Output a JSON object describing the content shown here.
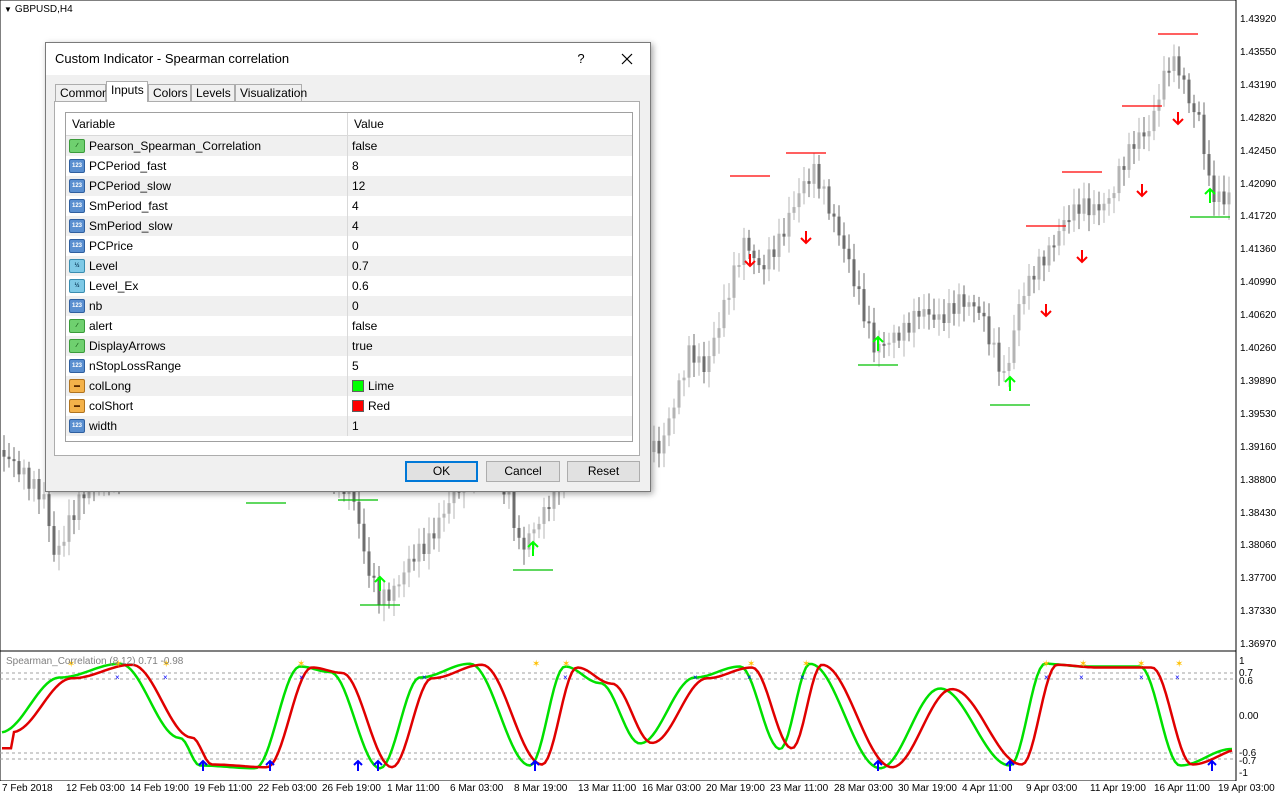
{
  "chart": {
    "title": "GBPUSD,H4",
    "price_labels": [
      "1.43920",
      "1.43550",
      "1.43190",
      "1.42820",
      "1.42450",
      "1.42090",
      "1.41720",
      "1.41360",
      "1.40990",
      "1.40620",
      "1.40260",
      "1.39890",
      "1.39530",
      "1.39160",
      "1.38800",
      "1.38430",
      "1.38060",
      "1.37700",
      "1.37330",
      "1.36970"
    ],
    "time_labels": [
      "7 Feb 2018",
      "12 Feb 03:00",
      "14 Feb 19:00",
      "19 Feb 11:00",
      "22 Feb 03:00",
      "26 Feb 19:00",
      "1 Mar 11:00",
      "6 Mar 03:00",
      "8 Mar 19:00",
      "13 Mar 11:00",
      "16 Mar 03:00",
      "20 Mar 19:00",
      "23 Mar 11:00",
      "28 Mar 03:00",
      "30 Mar 19:00",
      "4 Apr 11:00",
      "9 Apr 03:00",
      "11 Apr 19:00",
      "16 Apr 11:00",
      "19 Apr 03:00"
    ],
    "colors": {
      "bull": "#b4b4b4",
      "bear": "#6e6e6e",
      "arrow_up": "#00ff00",
      "arrow_down": "#ff0000",
      "stop_long": "#00c000",
      "stop_short": "#ff0000"
    }
  },
  "indicator": {
    "label": "Spearman_Correlation (8,12) 0.71 -0.98",
    "scale_labels": [
      "1",
      "0.7",
      "0.6",
      "0.00",
      "-0.6",
      "-0.7",
      "-1"
    ],
    "colors": {
      "fast": "#00e000",
      "slow": "#e00000",
      "signal": "#ffc000",
      "cross": "#0000ff"
    }
  },
  "dialog": {
    "title": "Custom Indicator - Spearman correlation",
    "help": "?",
    "tabs": [
      "Common",
      "Inputs",
      "Colors",
      "Levels",
      "Visualization"
    ],
    "active_tab": "Inputs",
    "columns": {
      "variable": "Variable",
      "value": "Value"
    },
    "params": [
      {
        "name": "Pearson_Spearman_Correlation",
        "value": "false",
        "type": "bool"
      },
      {
        "name": "PCPeriod_fast",
        "value": "8",
        "type": "int"
      },
      {
        "name": "PCPeriod_slow",
        "value": "12",
        "type": "int"
      },
      {
        "name": "SmPeriod_fast",
        "value": "4",
        "type": "int"
      },
      {
        "name": "SmPeriod_slow",
        "value": "4",
        "type": "int"
      },
      {
        "name": "PCPrice",
        "value": "0",
        "type": "int"
      },
      {
        "name": "Level",
        "value": "0.7",
        "type": "double"
      },
      {
        "name": "Level_Ex",
        "value": "0.6",
        "type": "double"
      },
      {
        "name": "nb",
        "value": "0",
        "type": "int"
      },
      {
        "name": "alert",
        "value": "false",
        "type": "bool"
      },
      {
        "name": "DisplayArrows",
        "value": "true",
        "type": "bool"
      },
      {
        "name": "nStopLossRange",
        "value": "5",
        "type": "int"
      },
      {
        "name": "colLong",
        "value": "Lime",
        "type": "color",
        "swatch": "#00ff00"
      },
      {
        "name": "colShort",
        "value": "Red",
        "type": "color",
        "swatch": "#ff0000"
      },
      {
        "name": "width",
        "value": "1",
        "type": "int"
      }
    ],
    "buttons": {
      "ok": "OK",
      "cancel": "Cancel",
      "reset": "Reset"
    }
  }
}
